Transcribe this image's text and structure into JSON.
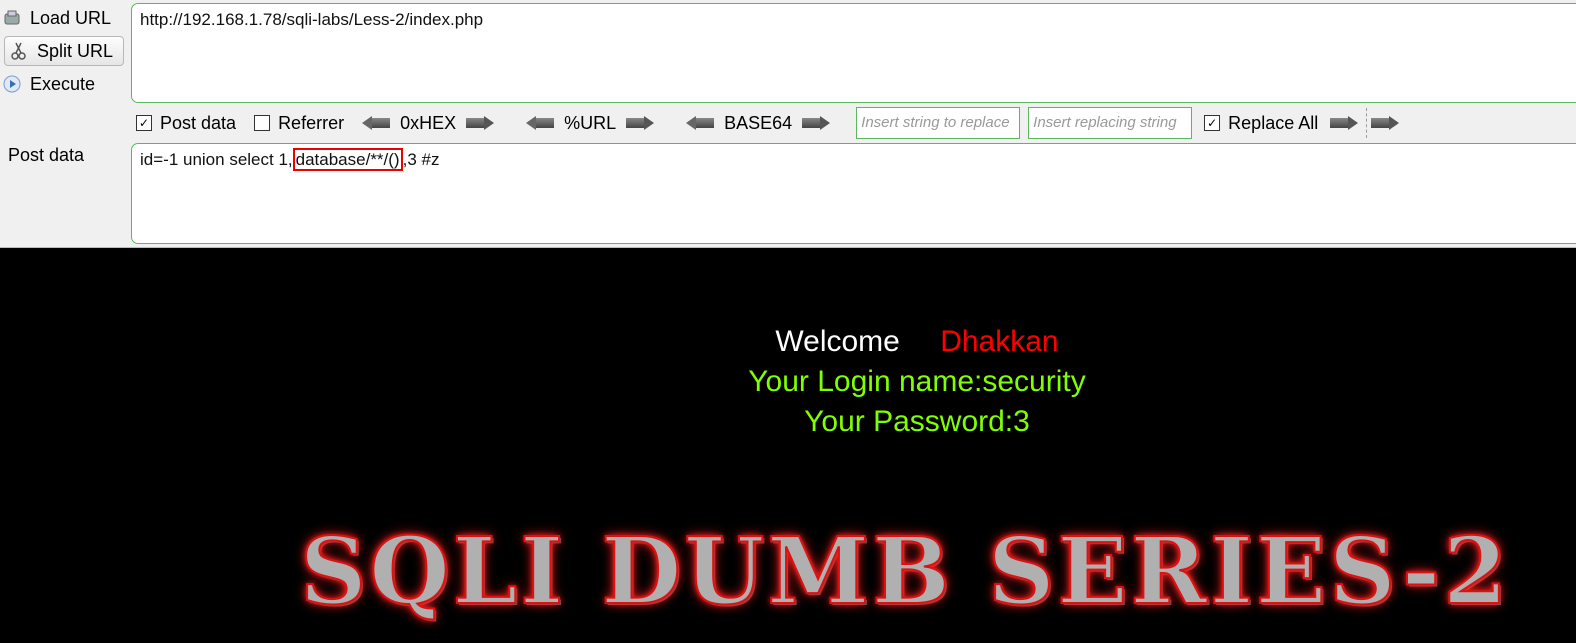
{
  "toolbar": {
    "load_url": "Load URL",
    "split_url": "Split URL",
    "execute": "Execute",
    "url_value": "http://192.168.1.78/sqli-labs/Less-2/index.php",
    "options": {
      "post_data": "Post data",
      "post_data_checked": true,
      "referrer": "Referrer",
      "referrer_checked": false,
      "hex": "0xHEX",
      "url": "%URL",
      "base64": "BASE64",
      "insert_string_placeholder": "Insert string to replace",
      "insert_replacing_placeholder": "Insert replacing string",
      "replace_all": "Replace All",
      "replace_all_checked": true
    },
    "post_label": "Post data",
    "post_value": {
      "before": "id=-1 union select 1,",
      "highlight": "database/**/()",
      "after": ",3 #z"
    }
  },
  "page": {
    "welcome": "Welcome",
    "user": "Dhakkan",
    "login_name": "Your Login name:security",
    "password": "Your Password:3",
    "banner": "SQLI DUMB SERIES-2"
  },
  "colors": {
    "field_border": "#5cb85c",
    "welcome": "#ffffff",
    "user": "#ff0000",
    "info": "#7fff00",
    "highlight_box": "#ee0000"
  }
}
